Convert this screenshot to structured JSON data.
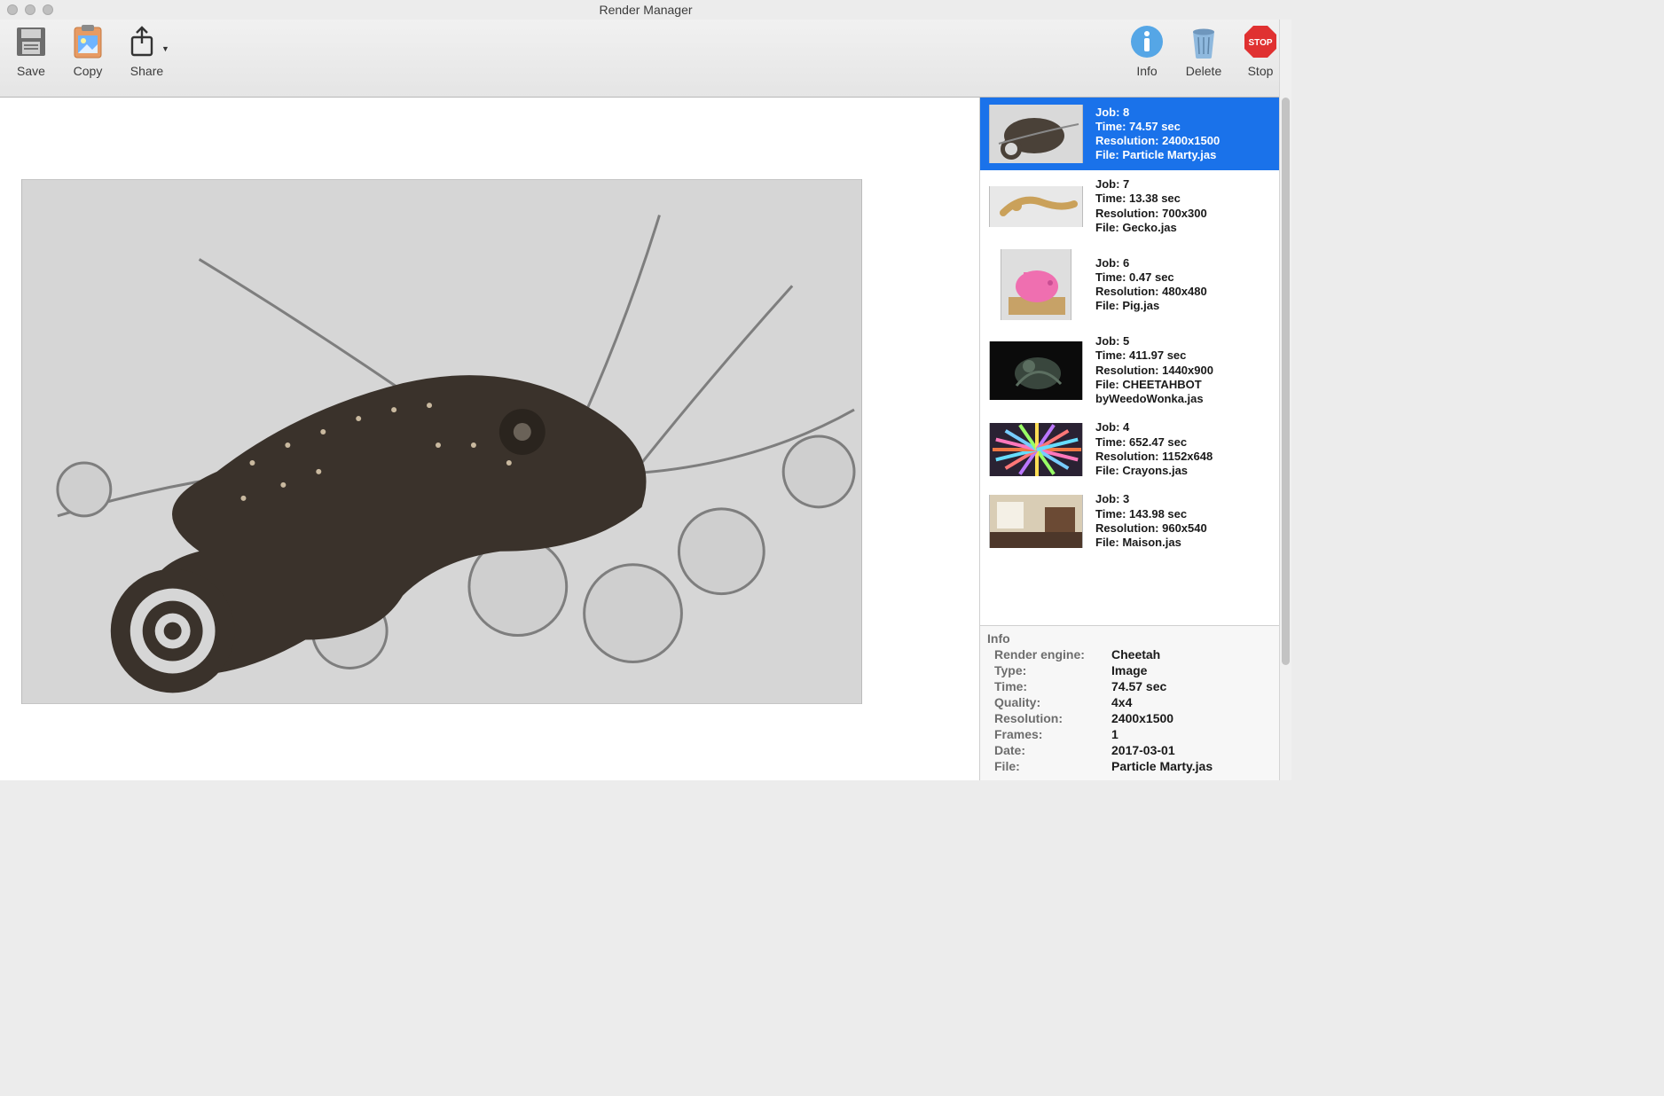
{
  "window": {
    "title": "Render Manager"
  },
  "toolbar": {
    "left": [
      {
        "label": "Save",
        "name": "save-button"
      },
      {
        "label": "Copy",
        "name": "copy-button"
      },
      {
        "label": "Share",
        "name": "share-button"
      }
    ],
    "right": [
      {
        "label": "Info",
        "name": "info-button"
      },
      {
        "label": "Delete",
        "name": "delete-button"
      },
      {
        "label": "Stop",
        "name": "stop-button"
      }
    ]
  },
  "jobs": [
    {
      "job": "8",
      "time": "74.57 sec",
      "resolution": "2400x1500",
      "file": "Particle Marty.jas",
      "selected": true
    },
    {
      "job": "7",
      "time": "13.38 sec",
      "resolution": "700x300",
      "file": "Gecko.jas"
    },
    {
      "job": "6",
      "time": "0.47 sec",
      "resolution": "480x480",
      "file": "Pig.jas"
    },
    {
      "job": "5",
      "time": "411.97 sec",
      "resolution": "1440x900",
      "file": "CHEETAHBOT byWeedoWonka.jas"
    },
    {
      "job": "4",
      "time": "652.47 sec",
      "resolution": "1152x648",
      "file": "Crayons.jas"
    },
    {
      "job": "3",
      "time": "143.98 sec",
      "resolution": "960x540",
      "file": "Maison.jas"
    }
  ],
  "labels": {
    "job_prefix": "Job: ",
    "time_prefix": "Time: ",
    "res_prefix": "Resolution: ",
    "file_prefix": "File: "
  },
  "info": {
    "heading": "Info",
    "render_engine_label": "Render engine:",
    "render_engine": "Cheetah",
    "type_label": "Type:",
    "type": "Image",
    "time_label": "Time:",
    "time": "74.57 sec",
    "quality_label": "Quality:",
    "quality": "4x4",
    "resolution_label": "Resolution:",
    "resolution": "2400x1500",
    "frames_label": "Frames:",
    "frames": "1",
    "date_label": "Date:",
    "date": "2017-03-01",
    "file_label": "File:",
    "file": "Particle Marty.jas"
  }
}
